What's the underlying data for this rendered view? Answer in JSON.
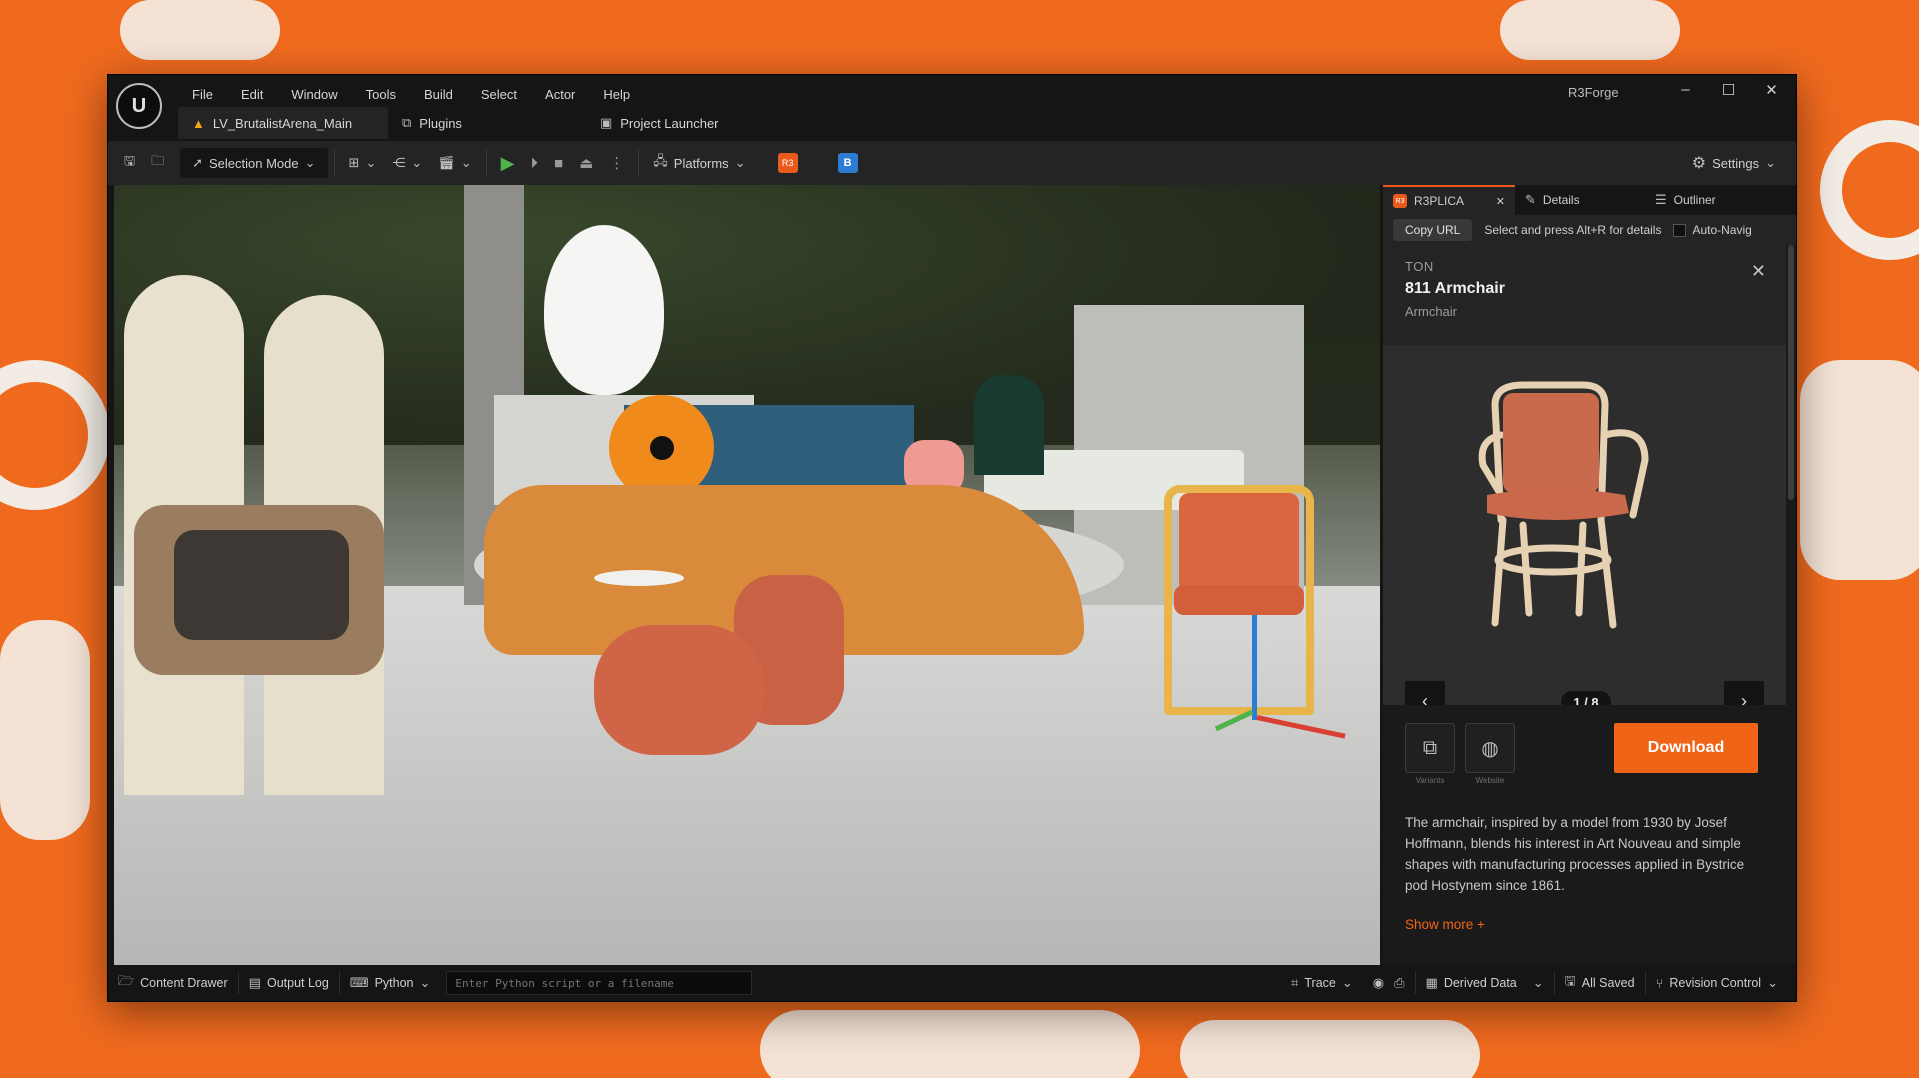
{
  "window": {
    "app_name": "R3Forge",
    "menu": [
      "File",
      "Edit",
      "Window",
      "Tools",
      "Build",
      "Select",
      "Actor",
      "Help"
    ],
    "tabs": {
      "level": "LV_BrutalistArena_Main",
      "plugins": "Plugins",
      "launcher": "Project Launcher"
    },
    "controls": {
      "minimize": "–",
      "maximize": "☐",
      "close": "✕"
    }
  },
  "toolbar": {
    "mode": "Selection Mode",
    "platforms": "Platforms",
    "settings": "Settings",
    "r3_badge": "R3",
    "b_badge": "B"
  },
  "panel": {
    "tabs": {
      "r3plica": "R3PLICA",
      "details": "Details",
      "outliner": "Outliner"
    },
    "copy_url": "Copy URL",
    "hint": "Select and press Alt+R for details",
    "auto_nav": "Auto-Navig",
    "asset": {
      "brand": "TON",
      "name": "811 Armchair",
      "type": "Armchair"
    },
    "pager": "1 / 8",
    "actions": {
      "variants": "Variants",
      "website": "Website",
      "download": "Download"
    },
    "description": "The armchair, inspired by a model from 1930 by Josef Hoffmann, blends his interest in Art Nouveau and simple shapes with manufacturing processes applied in Bystrice pod Hostynem since 1861.",
    "show_more": "Show more +"
  },
  "statusbar": {
    "content_drawer": "Content Drawer",
    "output_log": "Output Log",
    "python": "Python",
    "python_placeholder": "Enter Python script or a filename",
    "trace": "Trace",
    "derived_data": "Derived Data",
    "all_saved": "All Saved",
    "revision_control": "Revision Control"
  },
  "colors": {
    "accent": "#f06418",
    "bg_orange": "#f06a1e",
    "play_green": "#4fb34a"
  }
}
